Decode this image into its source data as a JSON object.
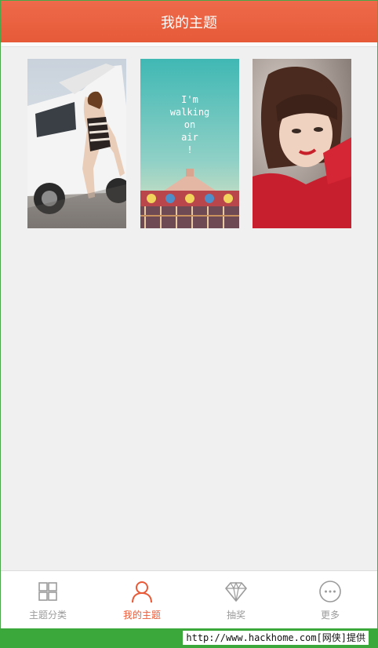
{
  "header": {
    "title": "我的主题"
  },
  "themes": [
    {
      "name": "theme-car-model"
    },
    {
      "name": "theme-walking-on-air",
      "overlay_text": "I'm\nwalking\non\nair\n!"
    },
    {
      "name": "theme-red-portrait"
    }
  ],
  "tabbar": {
    "items": [
      {
        "label": "主题分类",
        "icon": "grid-icon",
        "active": false
      },
      {
        "label": "我的主题",
        "icon": "person-icon",
        "active": true
      },
      {
        "label": "抽奖",
        "icon": "diamond-icon",
        "active": false
      },
      {
        "label": "更多",
        "icon": "more-icon",
        "active": false
      }
    ]
  },
  "footer": {
    "text": "http://www.hackhome.com[网侠]提供"
  },
  "colors": {
    "accent": "#e85a38",
    "inactive": "#9b9b9b",
    "background": "#f0f0f0"
  }
}
